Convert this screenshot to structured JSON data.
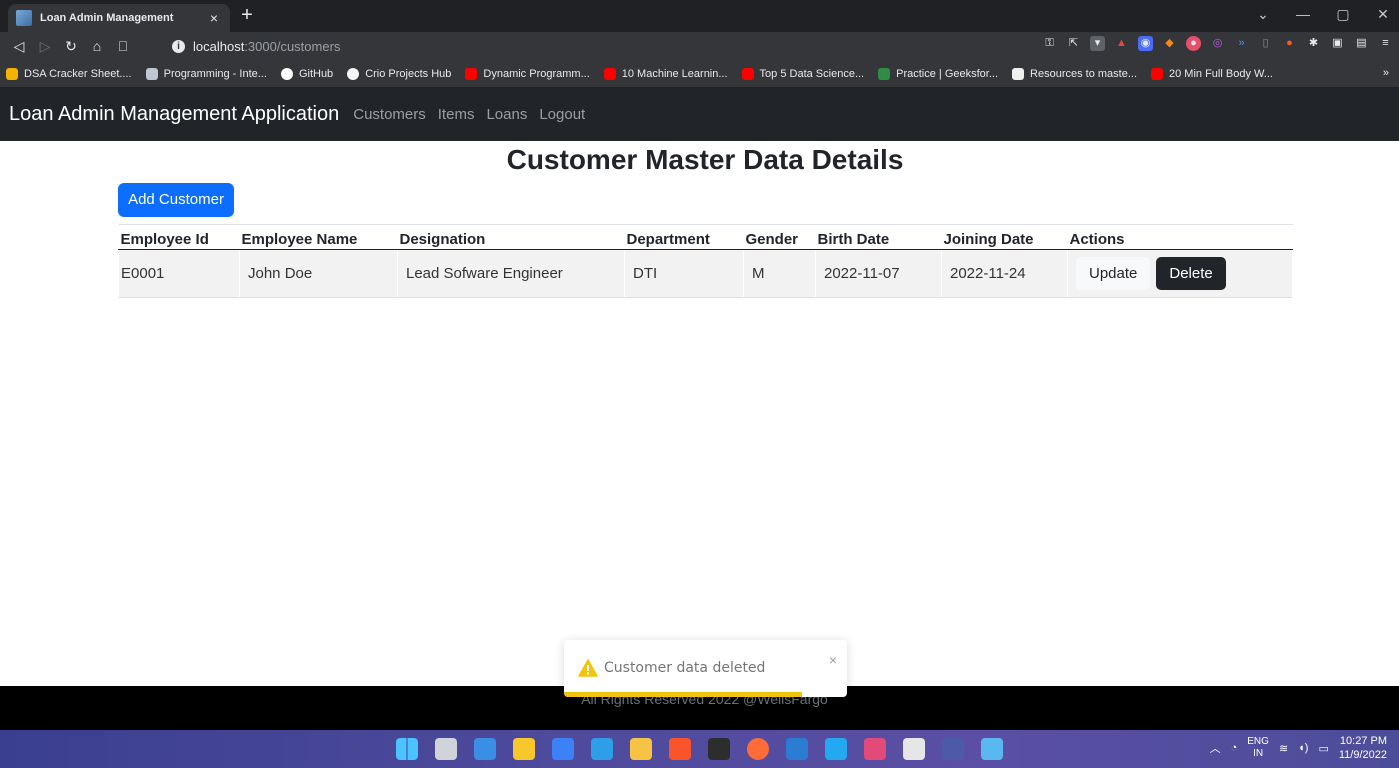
{
  "browser": {
    "tab_title": "Loan Admin Management",
    "tab_close": "×",
    "new_tab": "+",
    "url_host": "localhost",
    "url_path": ":3000/customers",
    "bookmarks": [
      {
        "label": "DSA Cracker Sheet....",
        "color": "#f4b400"
      },
      {
        "label": "Programming - Inte...",
        "color": "#bfc7d5"
      },
      {
        "label": "GitHub",
        "color": "#ffffff"
      },
      {
        "label": "Crio Projects Hub",
        "color": "#f5f5f5"
      },
      {
        "label": "Dynamic Programm...",
        "color": "#ff0000"
      },
      {
        "label": "10 Machine Learnin...",
        "color": "#ff0000"
      },
      {
        "label": "Top 5 Data Science...",
        "color": "#ff0000"
      },
      {
        "label": "Practice | Geeksfor...",
        "color": "#2f8d46"
      },
      {
        "label": "Resources to maste...",
        "color": "#000000"
      },
      {
        "label": "20 Min Full Body W...",
        "color": "#ff0000"
      }
    ],
    "bookmarks_more": "»"
  },
  "app": {
    "brand": "Loan Admin Management Application",
    "nav_links": [
      "Customers",
      "Items",
      "Loans",
      "Logout"
    ],
    "page_title": "Customer Master Data Details",
    "add_button": "Add Customer",
    "table": {
      "headers": [
        "Employee Id",
        "Employee Name",
        "Designation",
        "Department",
        "Gender",
        "Birth Date",
        "Joining Date",
        "Actions"
      ],
      "rows": [
        [
          "E0001",
          "John Doe",
          "Lead Sofware Engineer",
          "DTI",
          "M",
          "2022-11-07",
          "2022-11-24"
        ]
      ],
      "update_label": "Update",
      "delete_label": "Delete"
    },
    "footer": "All Rights Reserved 2022 @WellsFargo"
  },
  "toast": {
    "message": "Customer data deleted",
    "close": "×",
    "progress": 0.84,
    "color": "#f1c40f"
  },
  "taskbar": {
    "language_top": "ENG",
    "language_bottom": "IN",
    "time": "10:27 PM",
    "date": "11/9/2022"
  },
  "colors": {
    "primary": "#0d6efd",
    "dark": "#212529"
  }
}
